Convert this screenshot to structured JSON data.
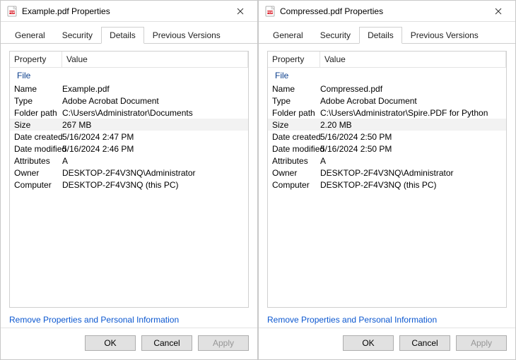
{
  "dialogs": [
    {
      "title": "Example.pdf Properties",
      "tabs": [
        "General",
        "Security",
        "Details",
        "Previous Versions"
      ],
      "activeTab": "Details",
      "headers": {
        "property": "Property",
        "value": "Value"
      },
      "sectionLabel": "File",
      "rows": [
        {
          "label": "Name",
          "value": "Example.pdf"
        },
        {
          "label": "Type",
          "value": "Adobe Acrobat Document"
        },
        {
          "label": "Folder path",
          "value": "C:\\Users\\Administrator\\Documents"
        },
        {
          "label": "Size",
          "value": "267 MB",
          "highlight": true
        },
        {
          "label": "Date created",
          "value": "5/16/2024 2:47 PM"
        },
        {
          "label": "Date modified",
          "value": "5/16/2024 2:46 PM"
        },
        {
          "label": "Attributes",
          "value": "A"
        },
        {
          "label": "Owner",
          "value": "DESKTOP-2F4V3NQ\\Administrator"
        },
        {
          "label": "Computer",
          "value": "DESKTOP-2F4V3NQ (this PC)"
        }
      ],
      "link": "Remove Properties and Personal Information",
      "buttons": {
        "ok": "OK",
        "cancel": "Cancel",
        "apply": "Apply"
      }
    },
    {
      "title": "Compressed.pdf Properties",
      "tabs": [
        "General",
        "Security",
        "Details",
        "Previous Versions"
      ],
      "activeTab": "Details",
      "headers": {
        "property": "Property",
        "value": "Value"
      },
      "sectionLabel": "File",
      "rows": [
        {
          "label": "Name",
          "value": "Compressed.pdf"
        },
        {
          "label": "Type",
          "value": "Adobe Acrobat Document"
        },
        {
          "label": "Folder path",
          "value": "C:\\Users\\Administrator\\Spire.PDF for Python"
        },
        {
          "label": "Size",
          "value": "2.20 MB",
          "highlight": true
        },
        {
          "label": "Date created",
          "value": "5/16/2024 2:50 PM"
        },
        {
          "label": "Date modified",
          "value": "5/16/2024 2:50 PM"
        },
        {
          "label": "Attributes",
          "value": "A"
        },
        {
          "label": "Owner",
          "value": "DESKTOP-2F4V3NQ\\Administrator"
        },
        {
          "label": "Computer",
          "value": "DESKTOP-2F4V3NQ (this PC)"
        }
      ],
      "link": "Remove Properties and Personal Information",
      "buttons": {
        "ok": "OK",
        "cancel": "Cancel",
        "apply": "Apply"
      }
    }
  ]
}
